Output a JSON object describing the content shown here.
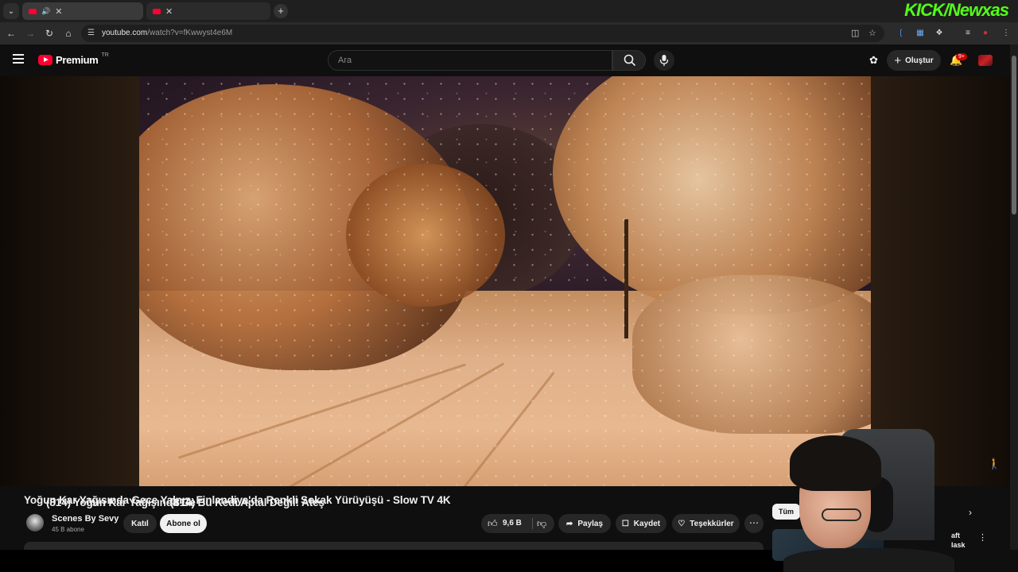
{
  "browser": {
    "tabs": [
      {
        "title": "(814) Yoğun Kar Yağışında Ge"
      },
      {
        "title": "(814) Bu Kedi Aptal Değil! Ateş"
      }
    ],
    "url_host": "youtube.com",
    "url_path": "/watch?v=fKwwyst4e6M",
    "overlay_brand": "KICK/Newxas"
  },
  "header": {
    "logo_text": "Premium",
    "country_code": "TR",
    "search_placeholder": "Ara",
    "create_label": "Oluştur",
    "notification_count": "9+"
  },
  "video": {
    "title": "Yoğun Kar Yağışında Gece Yalnız, Finlandiya'da Renkli Sokak Yürüyüşü - Slow TV 4K",
    "channel": "Scenes By Sevy",
    "subscribers": "45 B abone",
    "join_label": "Katıl",
    "subscribe_label": "Abone ol",
    "likes": "9,6 B",
    "share_label": "Paylaş",
    "save_label": "Kaydet",
    "thanks_label": "Teşekkürler"
  },
  "sidebar": {
    "chip_label": "Tüm",
    "next_title": "aft lask"
  },
  "colors": {
    "youtube_red": "#ff0033",
    "kick_green": "#53fc18",
    "background": "#0f0f0f"
  }
}
